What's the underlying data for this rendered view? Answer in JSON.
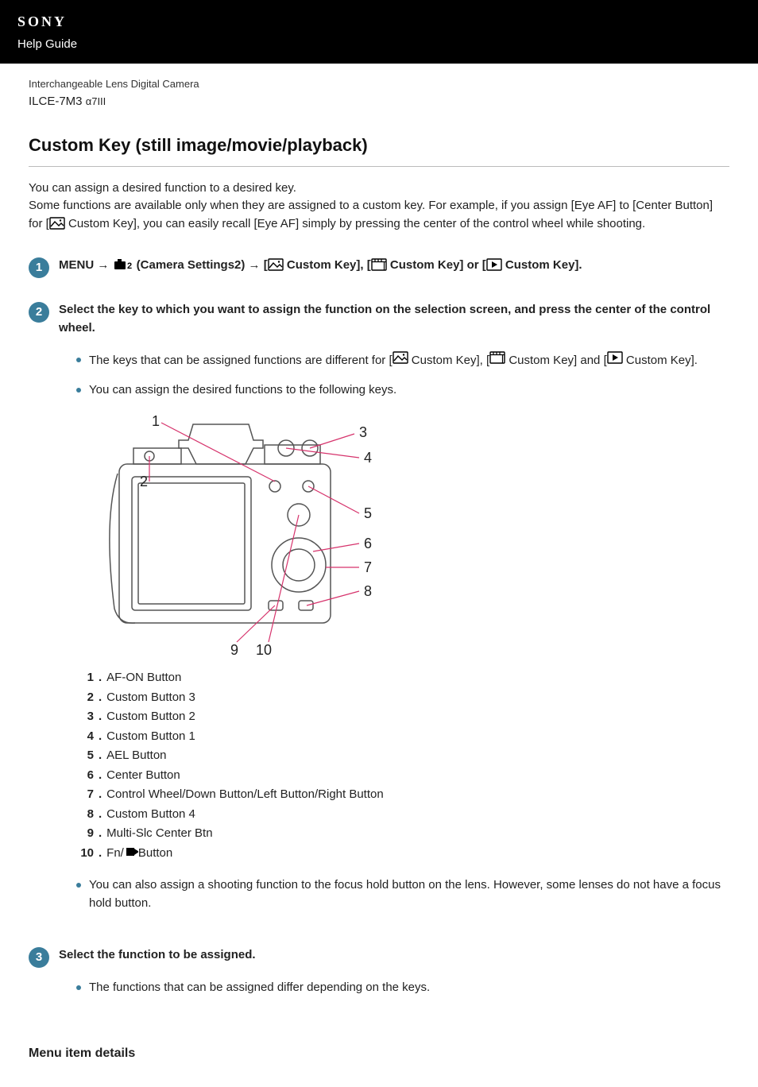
{
  "header": {
    "brand": "SONY",
    "guide_label": "Help Guide"
  },
  "product": {
    "line": "Interchangeable Lens Digital Camera",
    "model_code": "ILCE-7M3",
    "model_name": "α7III"
  },
  "page_title": "Custom Key (still image/movie/playback)",
  "intro": {
    "p1": "You can assign a desired function to a desired key.",
    "p2_pre": "Some functions are available only when they are assigned to a custom key. For example, if you assign [Eye AF] to [Center Button] for [",
    "p2_post": " Custom Key], you can easily recall [Eye AF] simply by pressing the center of the control wheel while shooting."
  },
  "steps": {
    "s1": {
      "num": "1",
      "prefix": "MENU → ",
      "cam2_icon_name": "camera-settings2-icon",
      "after_cam2": " (Camera Settings2) → [",
      "still_label": " Custom Key], [",
      "movie_label": " Custom Key] or [",
      "play_label": " Custom Key]."
    },
    "s2": {
      "num": "2",
      "title": "Select the key to which you want to assign the function on the selection screen, and press the center of the control wheel.",
      "bullet1_pre": "The keys that can be assigned functions are different for [",
      "bullet1_mid1": " Custom Key], [",
      "bullet1_mid2": " Custom Key] and [",
      "bullet1_post": " Custom Key].",
      "bullet2": "You can assign the desired functions to the following keys.",
      "keys": [
        {
          "n": "1",
          "label": "AF-ON Button"
        },
        {
          "n": "2",
          "label": "Custom Button 3"
        },
        {
          "n": "3",
          "label": "Custom Button 2"
        },
        {
          "n": "4",
          "label": "Custom Button 1"
        },
        {
          "n": "5",
          "label": "AEL Button"
        },
        {
          "n": "6",
          "label": "Center Button"
        },
        {
          "n": "7",
          "label": "Control Wheel/Down Button/Left Button/Right Button"
        },
        {
          "n": "8",
          "label": "Custom Button 4"
        },
        {
          "n": "9",
          "label": "Multi-Slc Center Btn"
        },
        {
          "n": "10",
          "label_pre": "Fn/",
          "label_post": " Button"
        }
      ],
      "bullet3": "You can also assign a shooting function to the focus hold button on the lens. However, some lenses do not have a focus hold button."
    },
    "s3": {
      "num": "3",
      "title": "Select the function to be assigned.",
      "bullet1": "The functions that can be assigned differ depending on the keys."
    }
  },
  "section_heading": "Menu item details",
  "icons": {
    "still": "still-image-icon",
    "movie": "movie-icon",
    "playback": "playback-icon",
    "send": "send-to-icon"
  },
  "diagram_numbers": [
    "1",
    "2",
    "3",
    "4",
    "5",
    "6",
    "7",
    "8",
    "9",
    "10"
  ]
}
